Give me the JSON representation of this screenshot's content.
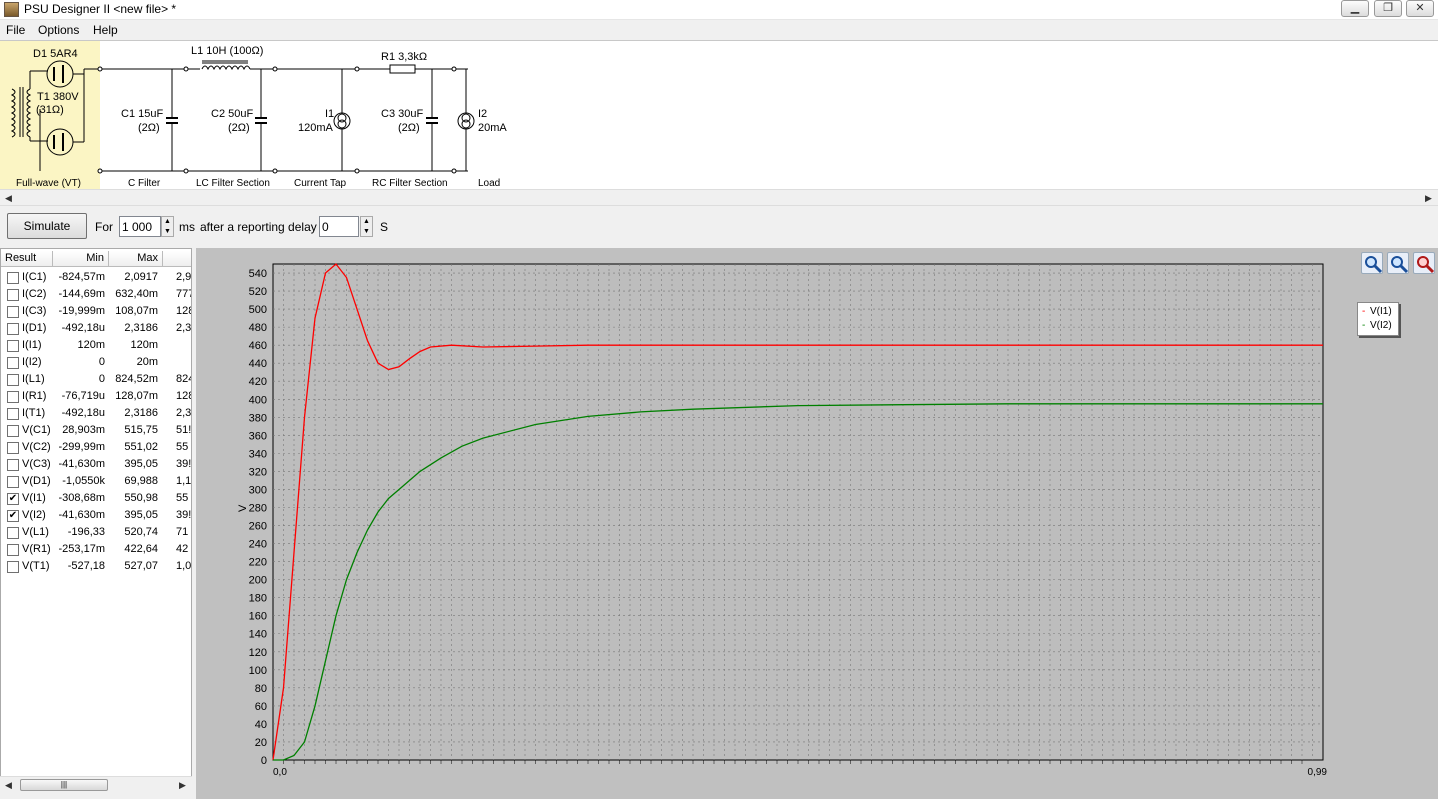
{
  "window": {
    "title": "PSU Designer II  <new file> *"
  },
  "menu": {
    "file": "File",
    "options": "Options",
    "help": "Help"
  },
  "schematic": {
    "components": {
      "d1": "D1 5AR4",
      "t1": "T1 380V",
      "t1_res": "(31Ω)",
      "c1": "C1 15uF",
      "c1_res": "(2Ω)",
      "l1": "L1 10H (100Ω)",
      "c2": "C2 50uF",
      "c2_res": "(2Ω)",
      "i1": "I1",
      "i1_val": "120mA",
      "r1": "R1 3,3kΩ",
      "c3": "C3 30uF",
      "c3_res": "(2Ω)",
      "i2": "I2",
      "i2_val": "20mA"
    },
    "sections": {
      "rectifier": "Full-wave (VT)",
      "c_filter": "C Filter",
      "lc_filter": "LC Filter Section",
      "current_tap": "Current Tap",
      "rc_filter": "RC Filter Section",
      "load": "Load"
    }
  },
  "toolbar": {
    "simulate": "Simulate",
    "for_label": "For",
    "duration_value": "1 000",
    "ms_label": "ms",
    "delay_label": "after a reporting delay of",
    "delay_value": "0",
    "s_label": "S"
  },
  "results": {
    "headers": {
      "result": "Result",
      "min": "Min",
      "max": "Max"
    },
    "rows": [
      {
        "checked": false,
        "name": "I(C1)",
        "min": "-824,57m",
        "max": "2,0917",
        "extra": "2,9"
      },
      {
        "checked": false,
        "name": "I(C2)",
        "min": "-144,69m",
        "max": "632,40m",
        "extra": "777,"
      },
      {
        "checked": false,
        "name": "I(C3)",
        "min": "-19,999m",
        "max": "108,07m",
        "extra": "128,"
      },
      {
        "checked": false,
        "name": "I(D1)",
        "min": "-492,18u",
        "max": "2,3186",
        "extra": "2,3"
      },
      {
        "checked": false,
        "name": "I(I1)",
        "min": "120m",
        "max": "120m",
        "extra": ""
      },
      {
        "checked": false,
        "name": "I(I2)",
        "min": "0",
        "max": "20m",
        "extra": ""
      },
      {
        "checked": false,
        "name": "I(L1)",
        "min": "0",
        "max": "824,52m",
        "extra": "824,"
      },
      {
        "checked": false,
        "name": "I(R1)",
        "min": "-76,719u",
        "max": "128,07m",
        "extra": "128,"
      },
      {
        "checked": false,
        "name": "I(T1)",
        "min": "-492,18u",
        "max": "2,3186",
        "extra": "2,3"
      },
      {
        "checked": false,
        "name": "V(C1)",
        "min": "28,903m",
        "max": "515,75",
        "extra": "51!"
      },
      {
        "checked": false,
        "name": "V(C2)",
        "min": "-299,99m",
        "max": "551,02",
        "extra": "55"
      },
      {
        "checked": false,
        "name": "V(C3)",
        "min": "-41,630m",
        "max": "395,05",
        "extra": "39!"
      },
      {
        "checked": false,
        "name": "V(D1)",
        "min": "-1,0550k",
        "max": "69,988",
        "extra": "1,12"
      },
      {
        "checked": true,
        "name": "V(I1)",
        "min": "-308,68m",
        "max": "550,98",
        "extra": "55"
      },
      {
        "checked": true,
        "name": "V(I2)",
        "min": "-41,630m",
        "max": "395,05",
        "extra": "39!"
      },
      {
        "checked": false,
        "name": "V(L1)",
        "min": "-196,33",
        "max": "520,74",
        "extra": "71"
      },
      {
        "checked": false,
        "name": "V(R1)",
        "min": "-253,17m",
        "max": "422,64",
        "extra": "42"
      },
      {
        "checked": false,
        "name": "V(T1)",
        "min": "-527,18",
        "max": "527,07",
        "extra": "1,05"
      }
    ]
  },
  "chart_data": {
    "type": "line",
    "ylabel": "V",
    "xlabel": "",
    "ylim": [
      0,
      550
    ],
    "yticks": [
      0,
      20,
      40,
      60,
      80,
      100,
      120,
      140,
      160,
      180,
      200,
      220,
      240,
      260,
      280,
      300,
      320,
      340,
      360,
      380,
      400,
      420,
      440,
      460,
      480,
      500,
      520,
      540
    ],
    "xlim": [
      0,
      1
    ],
    "x_tick_label_start": "0,0",
    "x_tick_label_end": "0,99",
    "grid": true,
    "legend_position": "top-right",
    "colors": {
      "V(I1)": "#ff0000",
      "V(I2)": "#008000"
    },
    "series": [
      {
        "name": "V(I1)",
        "x": [
          0,
          0.01,
          0.02,
          0.03,
          0.04,
          0.05,
          0.06,
          0.07,
          0.08,
          0.09,
          0.1,
          0.11,
          0.12,
          0.13,
          0.14,
          0.15,
          0.17,
          0.2,
          0.25,
          0.3,
          0.4,
          0.5,
          0.6,
          0.7,
          0.8,
          0.9,
          1.0
        ],
        "y": [
          0,
          80,
          230,
          380,
          490,
          540,
          550,
          535,
          500,
          465,
          440,
          433,
          436,
          445,
          453,
          458,
          460,
          458,
          459,
          460,
          460,
          460,
          460,
          460,
          460,
          460,
          460
        ]
      },
      {
        "name": "V(I2)",
        "x": [
          0,
          0.01,
          0.02,
          0.03,
          0.04,
          0.05,
          0.06,
          0.07,
          0.08,
          0.09,
          0.1,
          0.11,
          0.12,
          0.14,
          0.16,
          0.18,
          0.2,
          0.25,
          0.3,
          0.35,
          0.4,
          0.5,
          0.6,
          0.7,
          0.8,
          0.9,
          1.0
        ],
        "y": [
          0,
          0,
          5,
          20,
          60,
          110,
          160,
          200,
          230,
          255,
          275,
          290,
          300,
          320,
          335,
          348,
          357,
          372,
          381,
          386,
          389,
          393,
          394,
          395,
          395,
          395,
          395
        ]
      }
    ]
  }
}
